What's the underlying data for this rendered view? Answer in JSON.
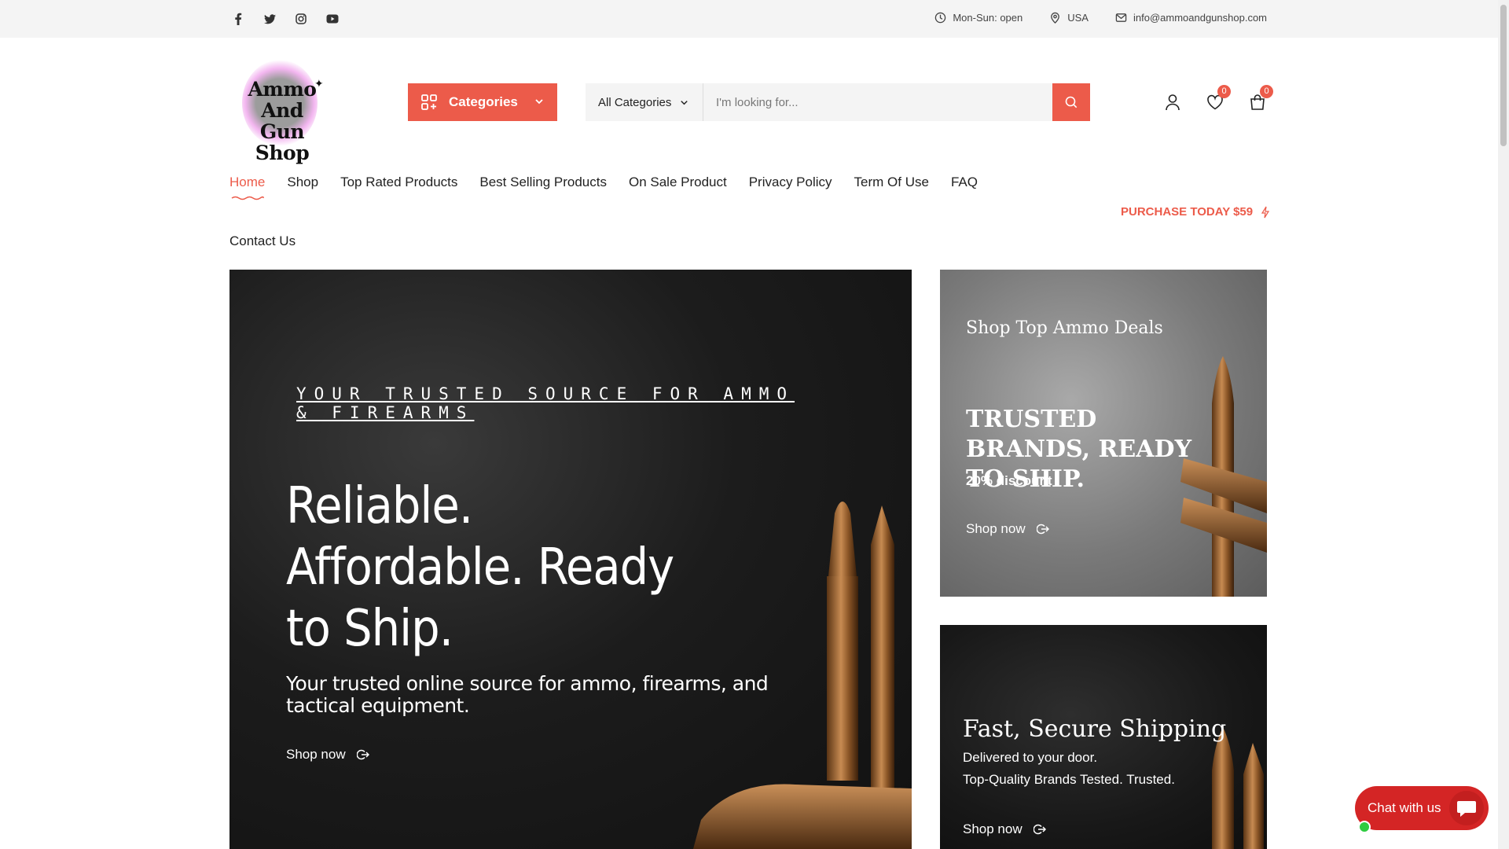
{
  "topbar": {
    "social": [
      "facebook-icon",
      "twitter-icon",
      "instagram-icon",
      "youtube-icon"
    ],
    "hours": "Mon-Sun: open",
    "location": "USA",
    "email": "info@ammoandgunshop.com"
  },
  "logo": {
    "text_line1": "Ammo And",
    "text_line2": "Gun Shop"
  },
  "header": {
    "categories_label": "Categories",
    "search_select": "All Categories",
    "search_placeholder": "I'm looking for...",
    "wishlist_count": "0",
    "cart_count": "0"
  },
  "nav": {
    "items": [
      "Home",
      "Shop",
      "Top Rated Products",
      "Best Selling Products",
      "On Sale Product",
      "Privacy Policy",
      "Term Of Use",
      "FAQ"
    ],
    "contact": "Contact Us",
    "promo": "PURCHASE TODAY $59"
  },
  "hero": {
    "kicker": "YOUR TRUSTED SOURCE FOR AMMO & FIREARMS",
    "headline_1": "Reliable.",
    "headline_2": "Affordable. Ready",
    "headline_3": "to Ship.",
    "sub": "Your trusted online source for ammo, firearms, and tactical equipment.",
    "cta": "Shop now"
  },
  "card1": {
    "title": "Shop Top Ammo Deals",
    "headline": "TRUSTED BRANDS, READY TO SHIP.",
    "discount": "20% discount",
    "cta": "Shop now"
  },
  "card2": {
    "title": "Fast, Secure Shipping",
    "line1": "Delivered to your door.",
    "line2": "Top-Quality Brands Tested. Trusted.",
    "cta": "Shop now"
  },
  "chat": {
    "label": "Chat with us"
  },
  "colors": {
    "accent": "#ec5b4a",
    "chat": "#d42525"
  }
}
